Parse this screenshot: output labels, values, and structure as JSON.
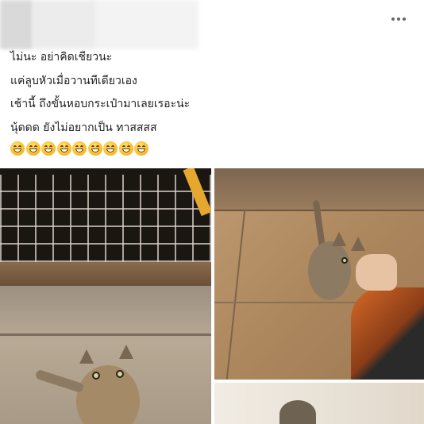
{
  "post": {
    "lines": [
      "ไม่นะ อย่าคิดเชียวนะ",
      "แค่ลูบหัวเมื่อวานทีเดียวเอง",
      "เช้านี้ ถึงขั้นหอบกระเป๋ามาเลยเรอะน่ะ",
      "นุ้ดดด ยังไม่อยากเป็น ทาสสสส"
    ],
    "emoji_count": 9,
    "emoji_icon": "grinning-squinting-face-icon"
  },
  "menu": {
    "icon": "more-horizontal-icon"
  },
  "photos": [
    {
      "subject": "kitten-at-fence"
    },
    {
      "subject": "kitten-with-hand"
    },
    {
      "subject": "kitten-doorway"
    }
  ],
  "colors": {
    "accent_orange": "#e6a72e",
    "text": "#1c1e21",
    "icon_gray": "#65676b"
  }
}
